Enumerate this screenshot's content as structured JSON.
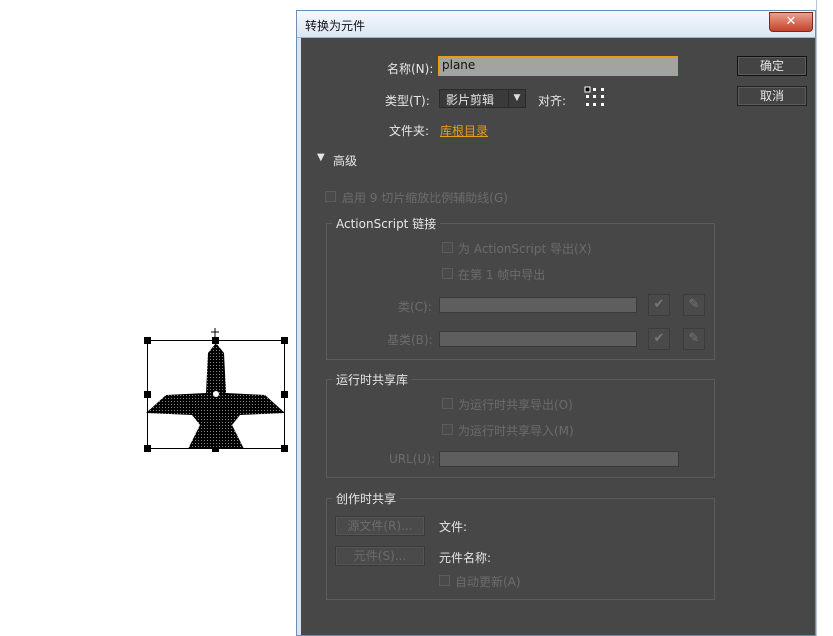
{
  "dialog": {
    "title": "转换为元件",
    "close_label": "✕",
    "name_label": "名称(N):",
    "name_value": "plane",
    "type_label": "类型(T):",
    "type_value": "影片剪辑",
    "align_label": "对齐:",
    "folder_label": "文件夹:",
    "folder_link": "库根目录",
    "ok_label": "确定",
    "cancel_label": "取消",
    "advanced_label": "高级",
    "nine_slice_label": "启用 9 切片缩放比例辅助线(G)",
    "as_group": {
      "title": "ActionScript 链接",
      "export_as": "为 ActionScript 导出(X)",
      "export_first_frame": "在第 1 帧中导出",
      "class_label": "类(C):",
      "base_class_label": "基类(B):"
    },
    "runtime_group": {
      "title": "运行时共享库",
      "export_runtime": "为运行时共享导出(O)",
      "import_runtime": "为运行时共享导入(M)",
      "url_label": "URL(U):"
    },
    "authoring_group": {
      "title": "创作时共享",
      "source_file_btn": "源文件(R)...",
      "symbol_btn": "元件(S)...",
      "file_label": "文件:",
      "symbol_name_label": "元件名称:",
      "auto_update": "自动更新(A)"
    }
  },
  "colors": {
    "accent": "#e89b18",
    "dialog_bg": "#474747"
  }
}
